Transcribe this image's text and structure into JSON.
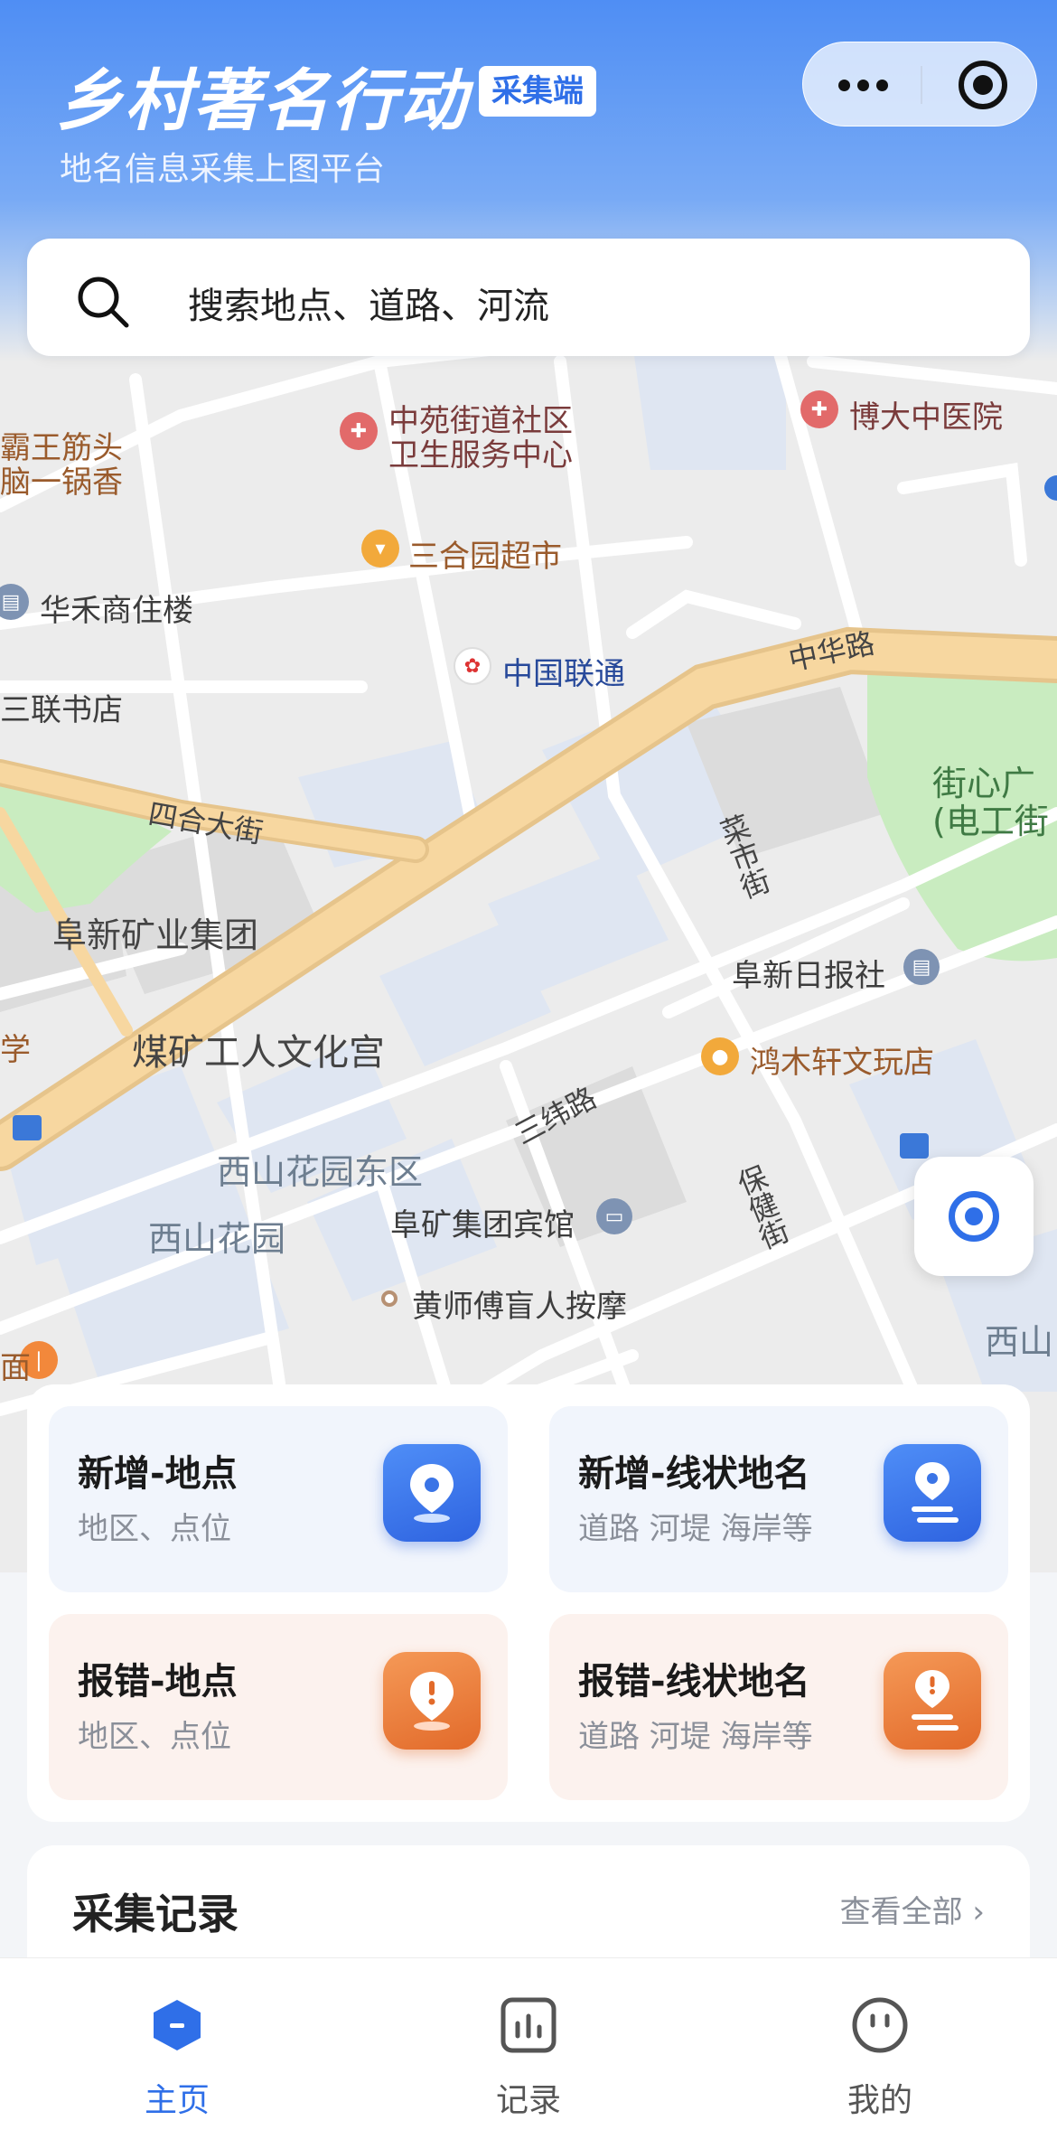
{
  "header": {
    "title": "乡村著名行动",
    "badge": "采集端",
    "subtitle": "地名信息采集上图平台"
  },
  "search": {
    "placeholder": "搜索地点、道路、河流"
  },
  "map_labels": {
    "p1": "霸王筋头",
    "p2": "脑一锅香",
    "p3": "中苑街道社区",
    "p4": "卫生服务中心",
    "p5": "博大中医院",
    "p6": "三合园超市",
    "p7": "华禾商住楼",
    "p8": "中国联通",
    "p9": "三联书店",
    "p10": "中华路",
    "p11": "街心广",
    "p12": "(电工街",
    "p13": "四合大街",
    "p14": "菜市街",
    "p15": "阜新矿业集团",
    "p16": "阜新日报社",
    "p17": "学",
    "p18": "煤矿工人文化宫",
    "p19": "鸿木轩文玩店",
    "p20": "三纬路",
    "p21": "西山花园东区",
    "p22": "保健街",
    "p23": "阜矿集团宾馆",
    "p24": "西山花园",
    "p25": "西山",
    "p26": "黄师傅盲人按摩",
    "p27": "面"
  },
  "actions": [
    {
      "title": "新增-地点",
      "subtitle": "地区、点位",
      "icon": "location-pin-icon"
    },
    {
      "title": "新增-线状地名",
      "subtitle": "道路 河堤 海岸等",
      "icon": "route-pin-icon"
    },
    {
      "title": "报错-地点",
      "subtitle": "地区、点位",
      "icon": "alert-pin-icon"
    },
    {
      "title": "报错-线状地名",
      "subtitle": "道路 河堤 海岸等",
      "icon": "alert-route-icon"
    }
  ],
  "records": {
    "title": "采集记录",
    "view_all": "查看全部 ›"
  },
  "tabs": [
    {
      "label": "主页",
      "icon": "home-icon",
      "active": true
    },
    {
      "label": "记录",
      "icon": "chart-icon",
      "active": false
    },
    {
      "label": "我的",
      "icon": "profile-icon",
      "active": false
    }
  ],
  "colors": {
    "primary": "#2f6fe8",
    "accent_orange": "#e26a2a",
    "map_road": "#f7d7a0",
    "map_park": "#c9ecc0",
    "map_water": "#dde6f5"
  }
}
